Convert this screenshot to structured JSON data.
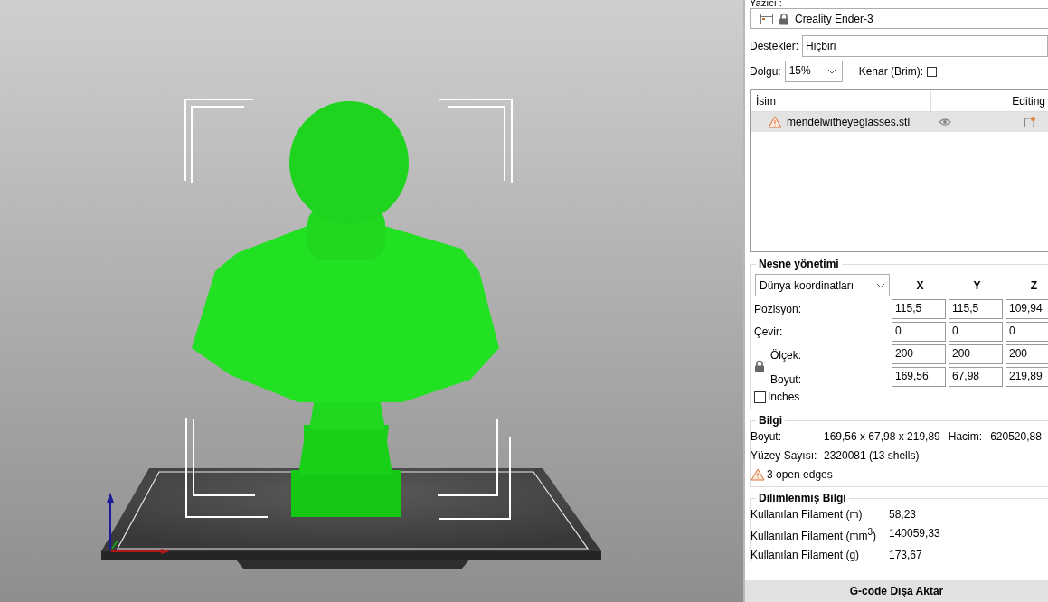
{
  "viewport": {
    "model": {
      "selected": true
    }
  },
  "panel": {
    "printer": {
      "label": "Yazıcı :",
      "name": "Creality Ender-3"
    },
    "supports": {
      "label": "Destekler:",
      "value": "Hiçbiri"
    },
    "infill": {
      "label": "Dolgu:",
      "value": "15%"
    },
    "brim": {
      "label": "Kenar (Brim):",
      "checked": false
    },
    "objects": {
      "columns": [
        {
          "label": "İsim"
        },
        {
          "label": "Editing"
        }
      ],
      "rows": [
        {
          "name": "mendelwitheyeglasses.stl",
          "warning": true,
          "visible": true,
          "selected": true
        }
      ]
    },
    "object_management": {
      "title": "Nesne yönetimi",
      "coordinates": "Dünya koordinatları",
      "axes": [
        "X",
        "Y",
        "Z"
      ],
      "rows": [
        {
          "label": "Pozisyon:",
          "values": [
            "115,5",
            "115,5",
            "109,94"
          ]
        },
        {
          "label": "Çevir:",
          "values": [
            "0",
            "0",
            "0"
          ]
        },
        {
          "label": "Ölçek:",
          "values": [
            "200",
            "200",
            "200"
          ]
        },
        {
          "label": "Boyut:",
          "values": [
            "169,56",
            "67,98",
            "219,89"
          ]
        }
      ],
      "inches": {
        "label": "Inches",
        "checked": false
      }
    },
    "info": {
      "title": "Bilgi",
      "size_label": "Boyut:",
      "size": "169,56 x 67,98 x 219,89",
      "volume_label": "Hacim:",
      "volume": "620520,88",
      "faces_label": "Yüzey Sayısı:",
      "faces": "2320081 (13 shells)",
      "warning": "3 open edges"
    },
    "sliced": {
      "title": "Dilimlenmiş Bilgi",
      "rows": [
        {
          "label": "Kullanılan Filament (m)",
          "value": "58,23"
        },
        {
          "label": "Kullanılan Filament (mm$^{3}$)",
          "value": "140059,33"
        },
        {
          "label": "Kullanılan Filament (g)",
          "value": "173,67"
        }
      ]
    },
    "export_button": "G-code Dışa Aktar"
  }
}
